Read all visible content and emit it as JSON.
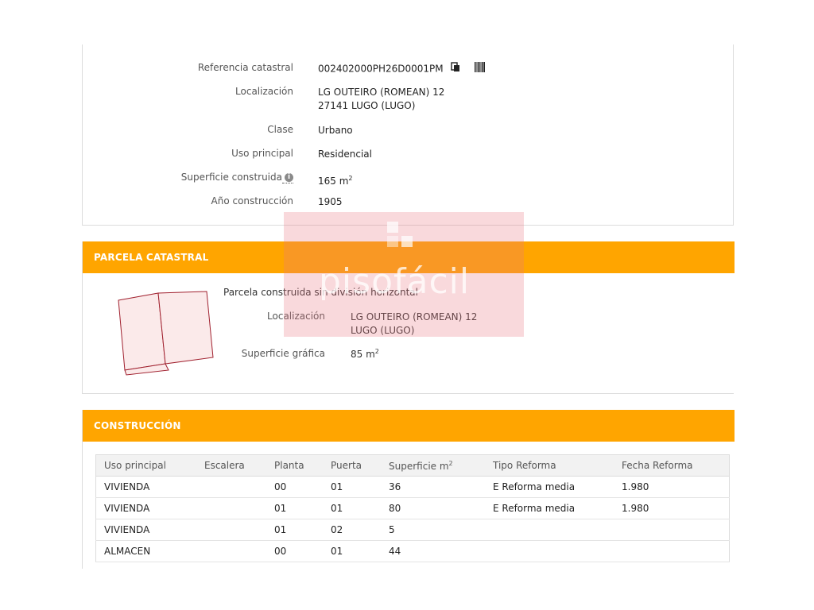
{
  "info": {
    "referencia_label": "Referencia catastral",
    "referencia_value": "002402000PH26D0001PM",
    "localizacion_label": "Localización",
    "localizacion_line1": "LG OUTEIRO (ROMEAN) 12",
    "localizacion_line2": "27141 LUGO (LUGO)",
    "clase_label": "Clase",
    "clase_value": "Urbano",
    "uso_label": "Uso principal",
    "uso_value": "Residencial",
    "superficie_label": "Superficie construida",
    "superficie_value": "165 m",
    "superficie_sup": "2",
    "anio_label": "Año construcción",
    "anio_value": "1905"
  },
  "parcela": {
    "header": "PARCELA CATASTRAL",
    "description": "Parcela construida sin división horizontal",
    "localizacion_label": "Localización",
    "localizacion_line1": "LG OUTEIRO (ROMEAN) 12",
    "localizacion_line2": "LUGO (LUGO)",
    "superficie_label": "Superficie gráfica",
    "superficie_value": "85 m",
    "superficie_sup": "2"
  },
  "construccion": {
    "header": "CONSTRUCCIÓN",
    "columns": [
      "Uso principal",
      "Escalera",
      "Planta",
      "Puerta",
      "Superficie m",
      "Tipo Reforma",
      "Fecha Reforma"
    ],
    "superficie_sup": "2",
    "rows": [
      [
        "VIVIENDA",
        "",
        "00",
        "01",
        "36",
        "E Reforma media",
        "1.980"
      ],
      [
        "VIVIENDA",
        "",
        "01",
        "01",
        "80",
        "E Reforma media",
        "1.980"
      ],
      [
        "VIVIENDA",
        "",
        "01",
        "02",
        "5",
        "",
        ""
      ],
      [
        "ALMACEN",
        "",
        "00",
        "01",
        "44",
        "",
        ""
      ]
    ]
  },
  "watermark": {
    "brand": "pisofácil"
  },
  "colors": {
    "section_header": "#ffa500",
    "parcel_stroke": "#a0202e",
    "parcel_fill": "#fbeaea"
  }
}
